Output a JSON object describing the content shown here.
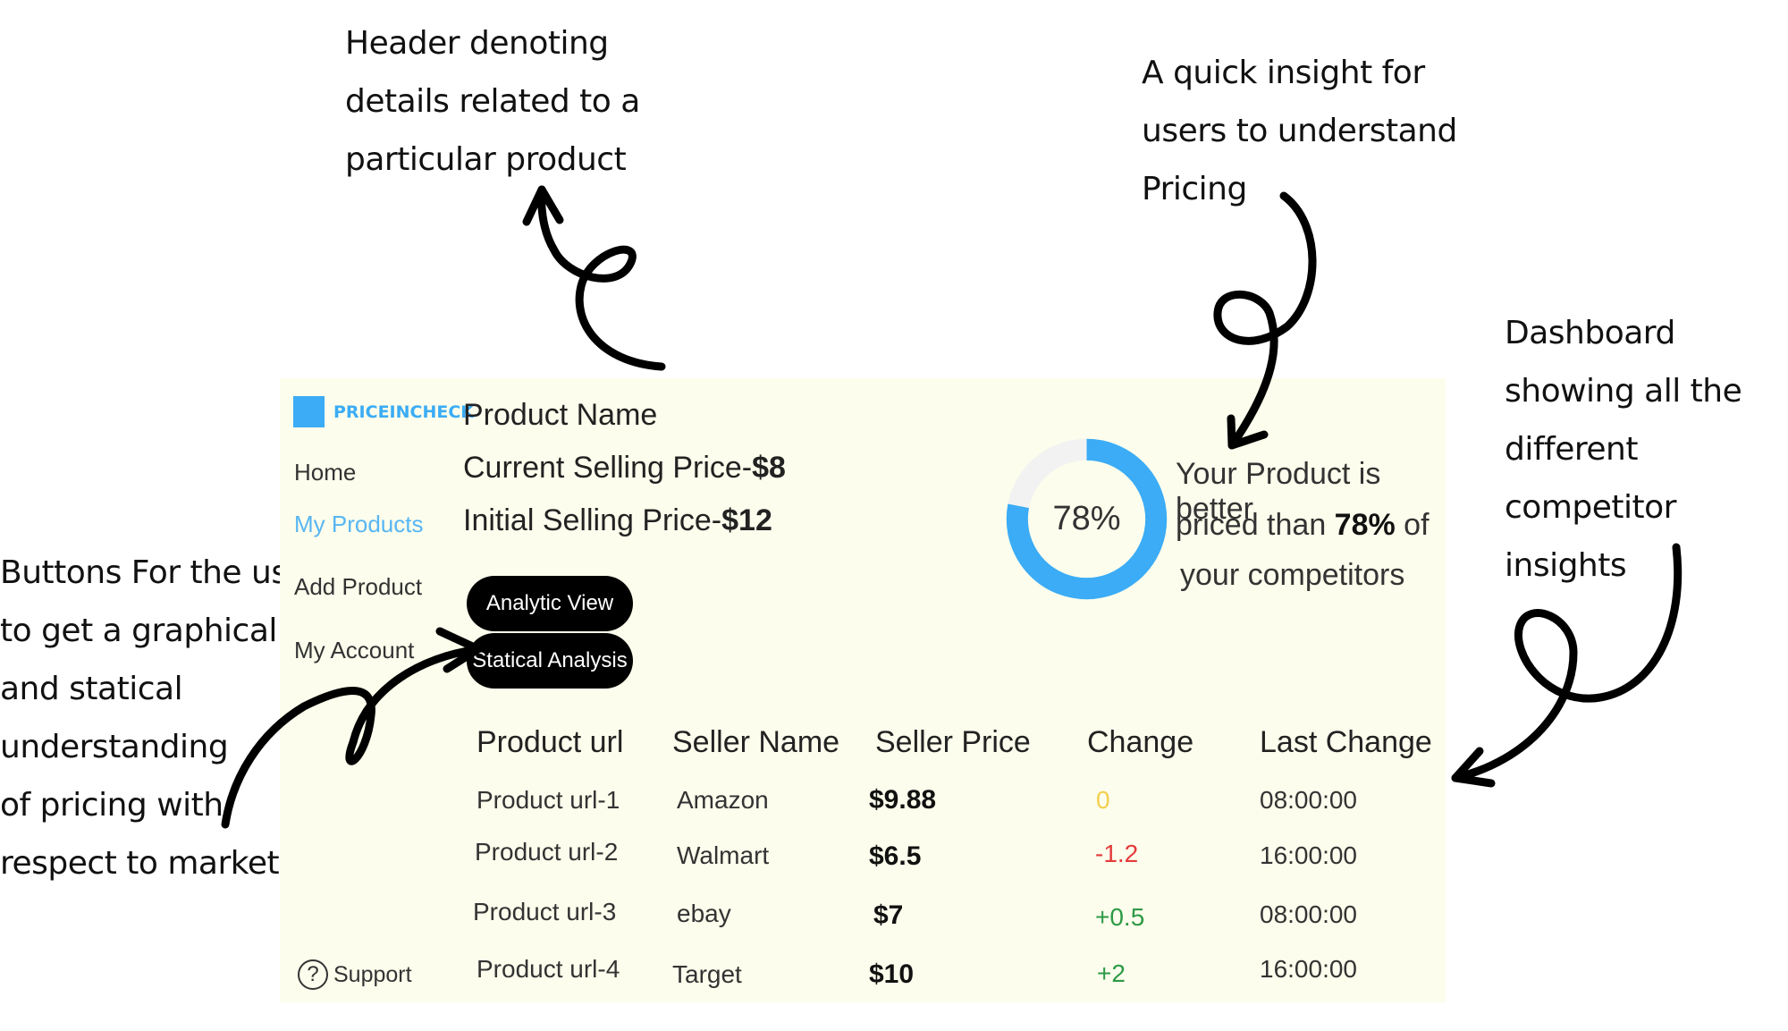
{
  "annotations": {
    "header": "Header denoting\ndetails related to a\nparticular product",
    "insight": "A quick insight for\nusers to understand\nPricing",
    "dashboard": "Dashboard\nshowing  all the\ndifferent competitor\ninsights",
    "buttons": "Buttons For the users\nto get a graphical\n and statical\nunderstanding\nof pricing with\nrespect to market"
  },
  "brand": {
    "name": "PRICEINCHECK",
    "color": "#3bacf5"
  },
  "nav": {
    "items": [
      {
        "label": "Home",
        "active": false
      },
      {
        "label": "My Products",
        "active": true
      },
      {
        "label": "Add Product",
        "active": false
      },
      {
        "label": "My Account",
        "active": false
      }
    ],
    "support": {
      "label": "Support",
      "icon": "help-circle-icon"
    }
  },
  "product": {
    "name": "Product Name",
    "current_label": "Current Selling Price-",
    "current_value": "$8",
    "initial_label": "Initial Selling Price-",
    "initial_value": "$12"
  },
  "buttons": {
    "analytic": "Analytic View",
    "statical": "Statical Analysis"
  },
  "insight": {
    "percent_value": 0.78,
    "percent_text": "78%",
    "line1": "Your Product is better",
    "line2_pre": "priced than ",
    "line2_value": "78%",
    "line2_post": " of",
    "line3": "your competitors",
    "ring_color": "#3bacf5",
    "track_color": "#f2f2f2"
  },
  "table": {
    "headers": [
      "Product url",
      "Seller Name",
      "Seller Price",
      "Change",
      "Last Change"
    ],
    "rows": [
      {
        "url": "Product url-1",
        "seller": "Amazon",
        "price": "$9.88",
        "change": "0",
        "last": "08:00:00"
      },
      {
        "url": "Product url-2",
        "seller": "Walmart",
        "price": "$6.5",
        "change": "-1.2",
        "last": "16:00:00"
      },
      {
        "url": "Product url-3",
        "seller": "ebay",
        "price": "$7",
        "change": "+0.5",
        "last": "08:00:00"
      },
      {
        "url": "Product url-4",
        "seller": "Target",
        "price": "$10",
        "change": "+2",
        "last": "16:00:00"
      }
    ],
    "change_colors": {
      "neutral": "#f4cf4f",
      "negative": "#e53b3b",
      "positive": "#2e9a46"
    }
  }
}
